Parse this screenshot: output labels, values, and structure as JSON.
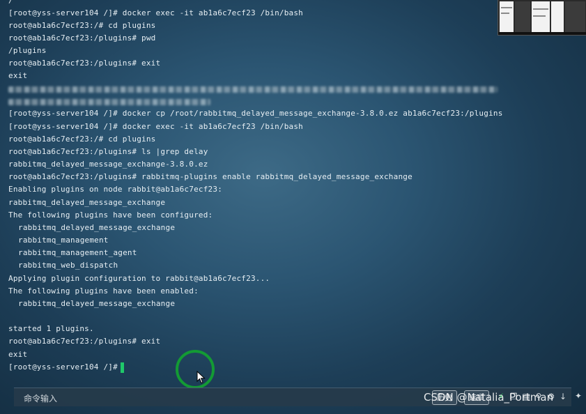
{
  "terminal": {
    "lines": [
      "/",
      "[root@yss-server104 /]# docker exec -it ab1a6c7ecf23 /bin/bash",
      "root@ab1a6c7ecf23:/# cd plugins",
      "root@ab1a6c7ecf23:/plugins# pwd",
      "/plugins",
      "root@ab1a6c7ecf23:/plugins# exit",
      "exit",
      "[root@yss-server104 /]# docker cp /root/rabbitmq_delayed_message_exchange-3.8.0.ez ab1a6c7ecf23:/plugins",
      "[root@yss-server104 /]# docker exec -it ab1a6c7ecf23 /bin/bash",
      "root@ab1a6c7ecf23:/# cd plugins",
      "root@ab1a6c7ecf23:/plugins# ls |grep delay",
      "rabbitmq_delayed_message_exchange-3.8.0.ez",
      "root@ab1a6c7ecf23:/plugins# rabbitmq-plugins enable rabbitmq_delayed_message_exchange",
      "Enabling plugins on node rabbit@ab1a6c7ecf23:",
      "rabbitmq_delayed_message_exchange",
      "The following plugins have been configured:",
      "rabbitmq_delayed_message_exchange",
      "rabbitmq_management",
      "rabbitmq_management_agent",
      "rabbitmq_web_dispatch",
      "Applying plugin configuration to rabbit@ab1a6c7ecf23...",
      "The following plugins have been enabled:",
      "rabbitmq_delayed_message_exchange",
      "started 1 plugins.",
      "root@ab1a6c7ecf23:/plugins# exit",
      "exit",
      "[root@yss-server104 /]#"
    ],
    "cursor_color": "#1fc86a"
  },
  "command_bar": {
    "input_label": "命令输入",
    "btn_history": "历史",
    "btn_options": "选项"
  },
  "icons": [
    "lightning-icon",
    "copy-icon",
    "paste-icon",
    "search-icon",
    "settings-icon",
    "download-icon",
    "expand-icon"
  ],
  "watermark": "CSDN @Natalia_Portman",
  "colors": {
    "terminal_text": "#e6eef3",
    "click_ring": "#139a34"
  }
}
